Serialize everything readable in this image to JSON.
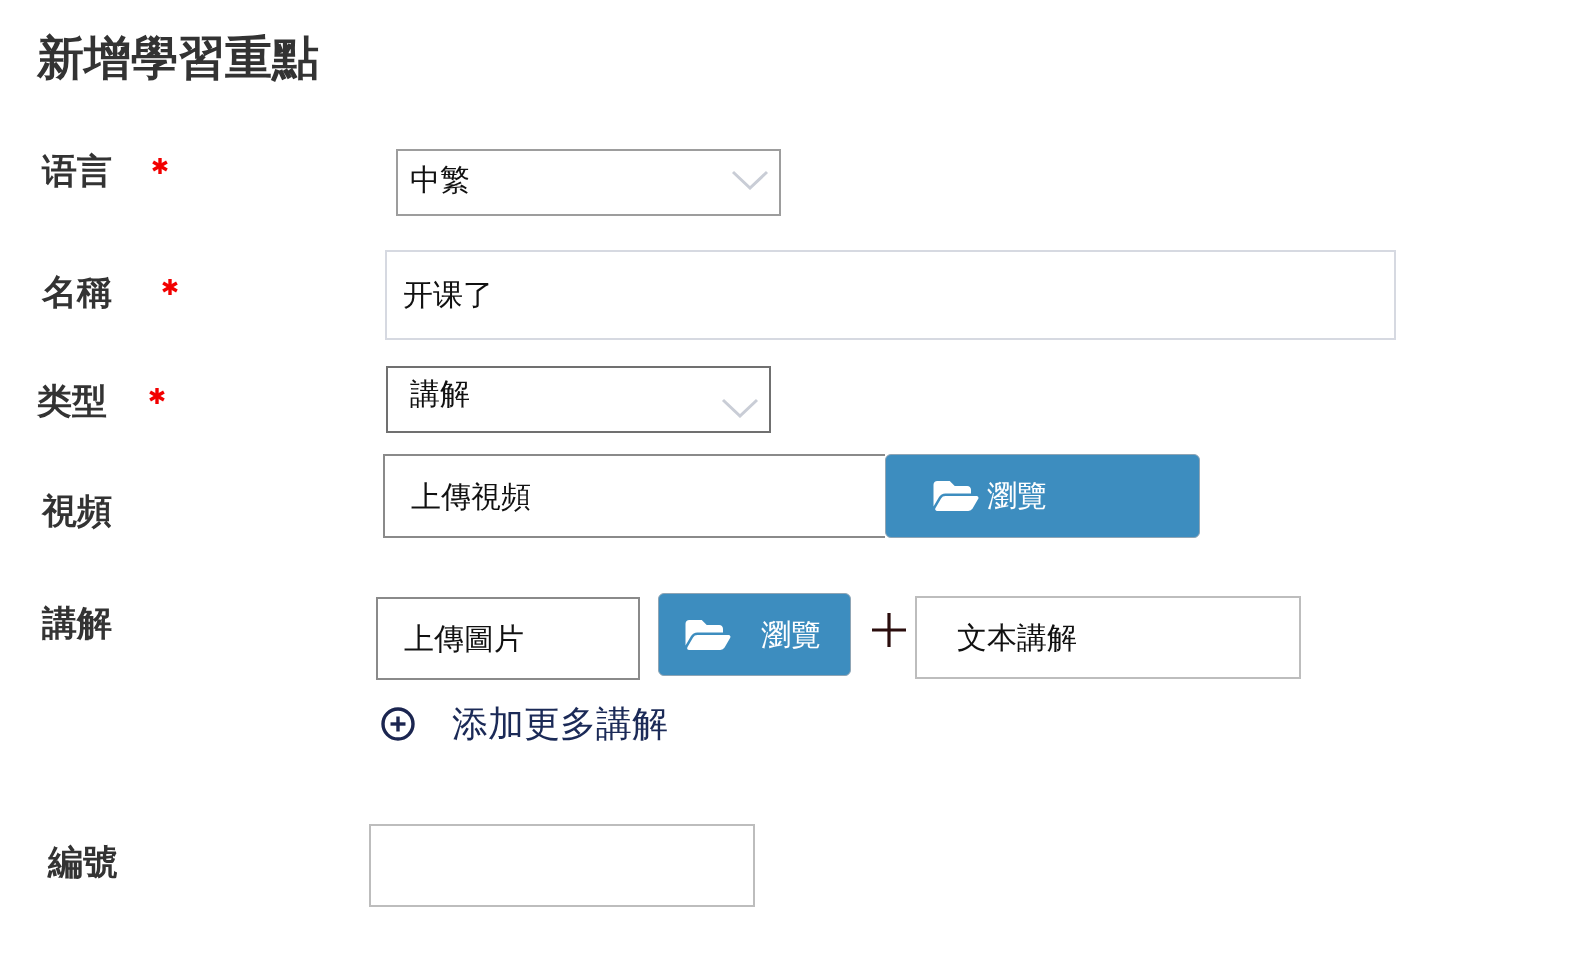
{
  "title": "新增學習重點",
  "fields": [
    {
      "kind": "select",
      "label": "语言",
      "required": true,
      "value": "中繁"
    },
    {
      "kind": "text",
      "label": "名稱",
      "required": true,
      "value": "开课了"
    },
    {
      "kind": "select",
      "label": "类型",
      "required": true,
      "value": "講解"
    },
    {
      "kind": "upload",
      "label": "視頻",
      "required": false,
      "placeholder": "上傳視頻",
      "button": "瀏覽"
    },
    {
      "kind": "explanations",
      "label": "講解",
      "required": false,
      "items": [
        {
          "image_placeholder": "上傳圖片",
          "button": "瀏覽",
          "text_placeholder": "文本講解"
        }
      ],
      "add_more": "添加更多講解"
    },
    {
      "kind": "text",
      "label": "編號",
      "required": false
    }
  ]
}
